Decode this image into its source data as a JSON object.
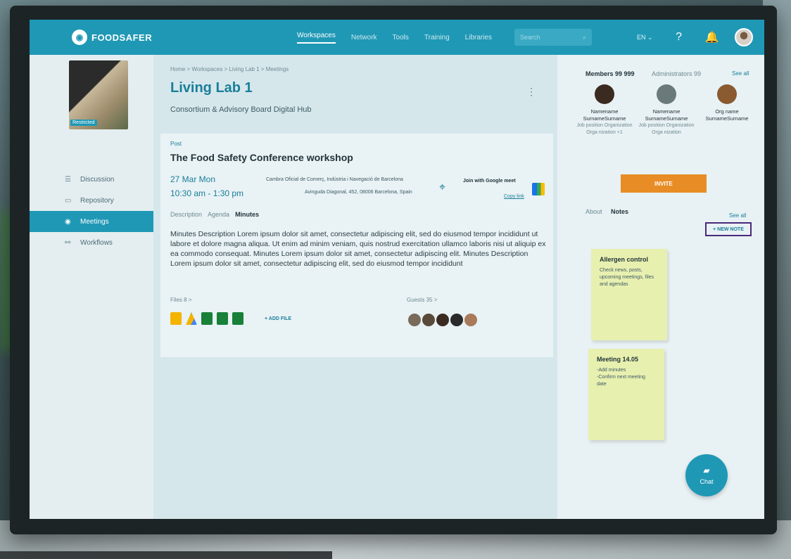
{
  "app": {
    "logo_text": "FOODSAFER"
  },
  "topnav": {
    "items": [
      "Workspaces",
      "Network",
      "Tools",
      "Training",
      "Libraries"
    ],
    "active": "Workspaces",
    "search_placeholder": "Search",
    "language": "EN"
  },
  "sidebar": {
    "image_badge": "Restricted",
    "items": [
      {
        "label": "Discussion",
        "icon": "chat-icon",
        "active": false
      },
      {
        "label": "Repository",
        "icon": "folder-icon",
        "active": false
      },
      {
        "label": "Meetings",
        "icon": "meetings-icon",
        "active": true
      },
      {
        "label": "Workflows",
        "icon": "workflow-icon",
        "active": false
      }
    ]
  },
  "main": {
    "breadcrumb": "Home > Workspaces > Living Lab 1 > Meetings",
    "title": "Living Lab 1",
    "subtitle": "Consortium & Advisory Board Digital Hub",
    "card": {
      "type": "Post",
      "title": "The Food Safety Conference workshop",
      "date": "27 Mar  Mon",
      "time": "10:30 am - 1:30 pm",
      "location_name": "Cambra Oficial de Comerç, Indústria i Navegació de Barcelona",
      "location_address": "Avinguda Diagonal, 452, 08006 Barcelona, Spain",
      "meet_label": "Join with Google meet",
      "copy_link": "Copy link",
      "tabs": [
        "Description",
        "Agenda",
        "Minutes"
      ],
      "active_tab": "Minutes",
      "minutes_text": "Minutes Description Lorem ipsum dolor sit amet, consectetur adipiscing elit, sed do eiusmod tempor incididunt ut labore et dolore magna aliqua. Ut enim ad minim veniam, quis nostrud exercitation ullamco laboris nisi ut aliquip ex ea commodo consequat. Minutes Lorem ipsum dolor sit amet, consectetur adipiscing elit. Minutes Description Lorem ipsum dolor sit amet, consectetur adipiscing elit, sed do eiusmod tempor incididunt",
      "files_label": "Files 8 >",
      "add_file": "+ ADD FILE",
      "guests_label": "Guests 35 >"
    }
  },
  "right": {
    "members_label": "Members 99 999",
    "admins_label": "Administrators 99",
    "see_all": "See all",
    "members": [
      {
        "name": "Namename SurnameSurname",
        "meta": "Job position Organization Orga nization +1"
      },
      {
        "name": "Namename SurnameSurname",
        "meta": "Job position Organization Orga nization"
      },
      {
        "name": "Org name SurnameSurname",
        "meta": ""
      }
    ],
    "invite": "INVITE",
    "tabs": {
      "about": "About",
      "notes": "Notes"
    },
    "see_all_notes": "See all",
    "new_note": "+ NEW NOTE",
    "notes": [
      {
        "title": "Allergen control",
        "body": "Check news, posts, upcoming meetings, files and agendas"
      },
      {
        "title": "Meeting 14.05",
        "body": "-Add minutes\n-Confirm next meeting date"
      }
    ],
    "chat": "Chat"
  },
  "colors": {
    "primary": "#1f98b5",
    "accent": "#e88d25",
    "note": "#e8f0b0"
  }
}
